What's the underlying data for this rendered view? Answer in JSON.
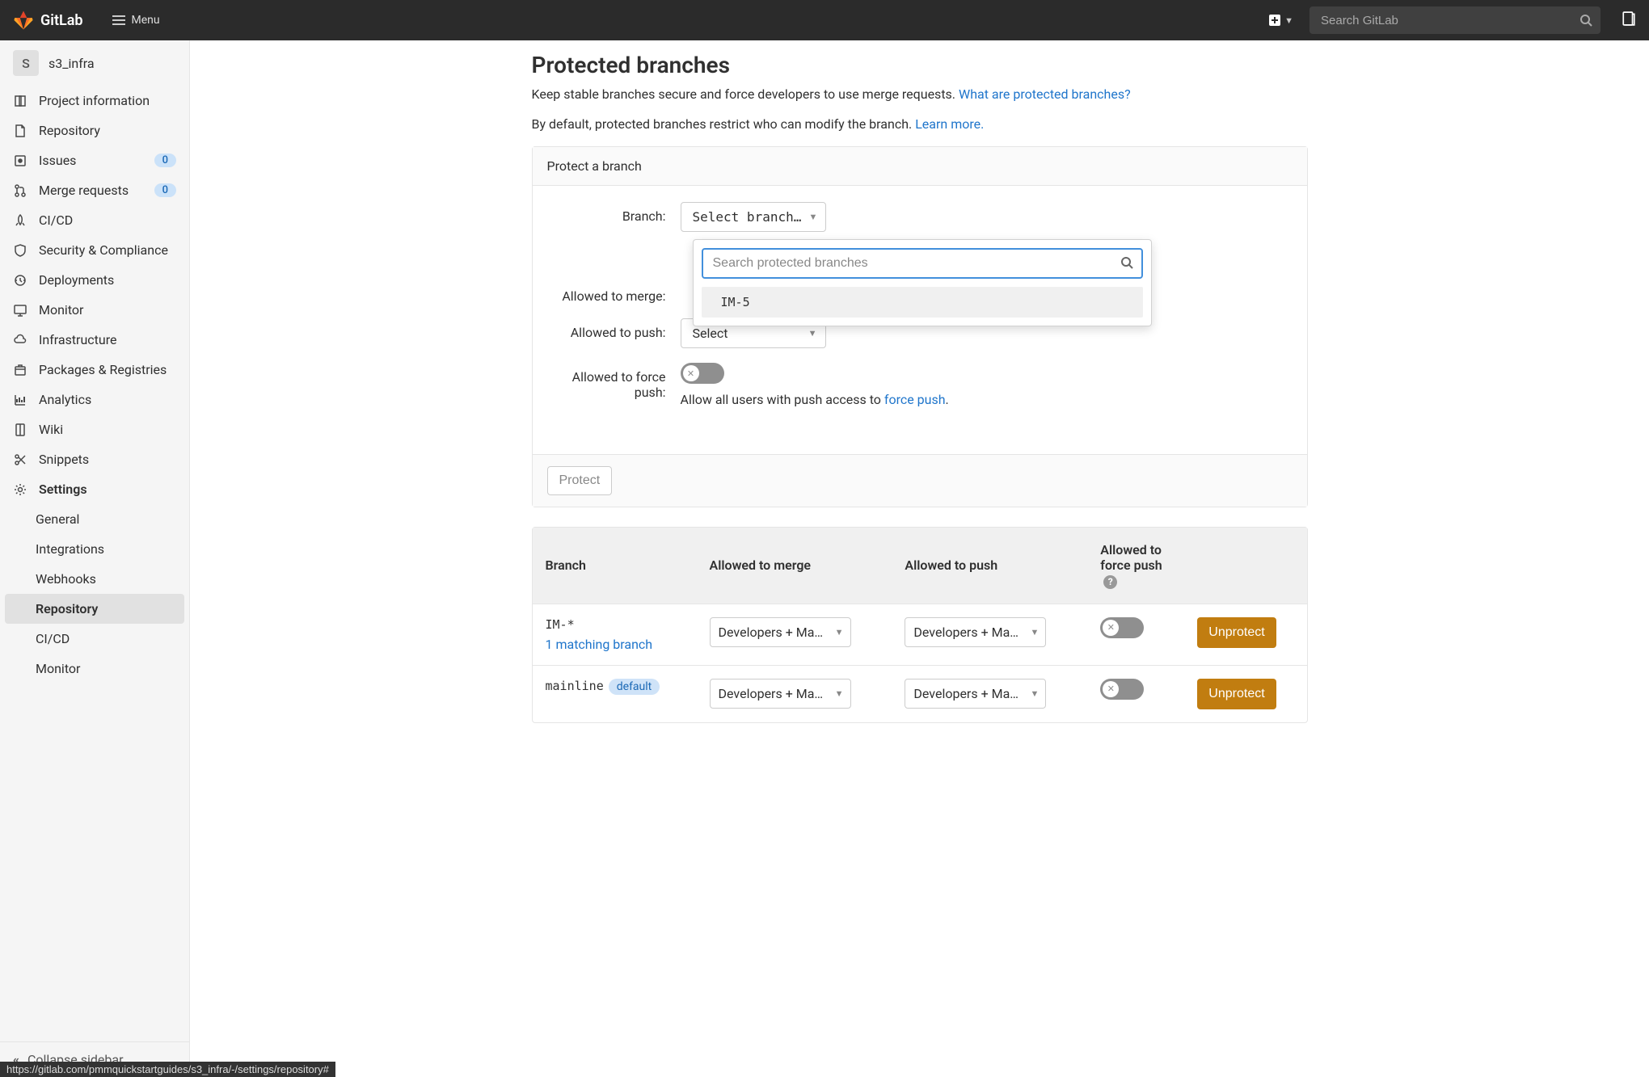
{
  "header": {
    "logo_text": "GitLab",
    "menu_label": "Menu",
    "search_placeholder": "Search GitLab"
  },
  "sidebar": {
    "project_initial": "S",
    "project_name": "s3_infra",
    "items": [
      {
        "label": "Project information",
        "icon": "info"
      },
      {
        "label": "Repository",
        "icon": "file"
      },
      {
        "label": "Issues",
        "icon": "issue",
        "badge": "0"
      },
      {
        "label": "Merge requests",
        "icon": "merge",
        "badge": "0"
      },
      {
        "label": "CI/CD",
        "icon": "rocket"
      },
      {
        "label": "Security & Compliance",
        "icon": "shield"
      },
      {
        "label": "Deployments",
        "icon": "deploy"
      },
      {
        "label": "Monitor",
        "icon": "monitor"
      },
      {
        "label": "Infrastructure",
        "icon": "cloud"
      },
      {
        "label": "Packages & Registries",
        "icon": "package"
      },
      {
        "label": "Analytics",
        "icon": "chart"
      },
      {
        "label": "Wiki",
        "icon": "book"
      },
      {
        "label": "Snippets",
        "icon": "scissors"
      },
      {
        "label": "Settings",
        "icon": "gear",
        "bold": true
      }
    ],
    "settings_sub": [
      {
        "label": "General"
      },
      {
        "label": "Integrations"
      },
      {
        "label": "Webhooks"
      },
      {
        "label": "Repository",
        "active": true
      },
      {
        "label": "CI/CD"
      },
      {
        "label": "Monitor"
      }
    ],
    "collapse_label": "Collapse sidebar"
  },
  "main": {
    "title": "Protected branches",
    "desc1": "Keep stable branches secure and force developers to use merge requests. ",
    "desc1_link": "What are protected branches?",
    "desc2": "By default, protected branches restrict who can modify the branch. ",
    "desc2_link": "Learn more.",
    "panel_header": "Protect a branch",
    "form": {
      "branch_label": "Branch:",
      "branch_select": "Select branch…",
      "merge_label": "Allowed to merge:",
      "push_label": "Allowed to push:",
      "push_select": "Select",
      "force_label": "Allowed to force push:",
      "force_helper_pre": "Allow all users with push access to ",
      "force_helper_link": "force push",
      "force_helper_post": "."
    },
    "dropdown": {
      "search_placeholder": "Search protected branches",
      "option1": "IM-5"
    },
    "protect_button": "Protect",
    "table": {
      "col1": "Branch",
      "col2": "Allowed to merge",
      "col3": "Allowed to push",
      "col4": "Allowed to force push",
      "rows": [
        {
          "branch": "IM-*",
          "match": "1 matching branch",
          "merge": "Developers + Ma…",
          "push": "Developers + Ma…",
          "unprotect": "Unprotect"
        },
        {
          "branch": "mainline",
          "default_tag": "default",
          "merge": "Developers + Ma…",
          "push": "Developers + Ma…",
          "unprotect": "Unprotect"
        }
      ]
    }
  },
  "status_url": "https://gitlab.com/pmmquickstartguides/s3_infra/-/settings/repository#"
}
